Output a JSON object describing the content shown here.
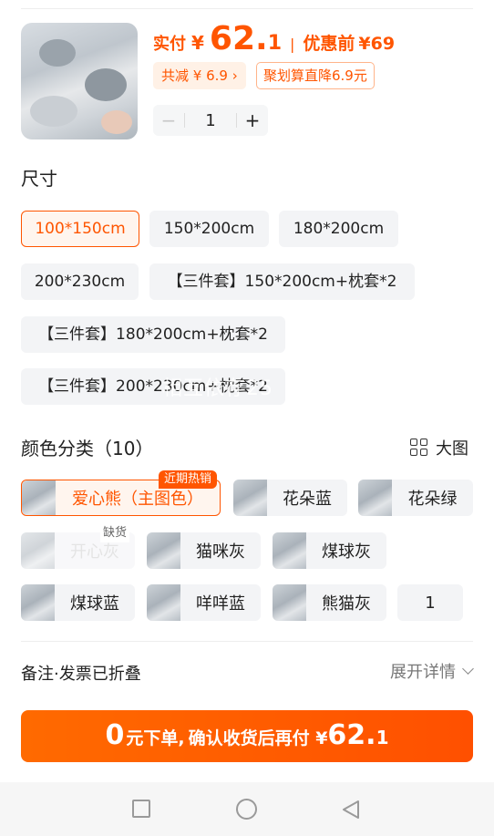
{
  "product": {
    "price_label": "实付",
    "yen": "¥",
    "price_int": "62.",
    "price_dec": "1",
    "divider": "|",
    "orig_label": "优惠前",
    "orig_price": "¥69",
    "discount_tag": "共减 ¥ 6.9 ›",
    "promo_tag": "聚划算直降6.9元",
    "quantity": "1",
    "minus": "−",
    "plus": "+"
  },
  "size": {
    "heading": "尺寸",
    "options": [
      "100*150cm",
      "150*200cm",
      "180*200cm",
      "200*230cm",
      "【三件套】150*200cm+枕套*2",
      "【三件套】180*200cm+枕套*2",
      "【三件套】200*230cm+枕套*2"
    ],
    "selected": "100*150cm",
    "watermark": "相互依存25"
  },
  "color": {
    "heading": "颜色分类（10）",
    "big_view": "大图",
    "hot_badge": "近期热销",
    "out_of_stock": "缺货",
    "options": [
      "爱心熊（主图色）",
      "花朵蓝",
      "花朵绿",
      "开心灰",
      "猫咪灰",
      "煤球灰",
      "煤球蓝",
      "咩咩蓝",
      "熊猫灰",
      "1"
    ]
  },
  "remark": {
    "label": "备注·发票已折叠",
    "expand": "展开详情"
  },
  "buy_button": {
    "p1": "0",
    "p2": "元下单,",
    "p3": "确认收货后再付 ¥",
    "p4": "62.",
    "p5": "1"
  },
  "colors": {
    "accent": "#ff5500",
    "chip_bg": "#f3f4f6"
  }
}
